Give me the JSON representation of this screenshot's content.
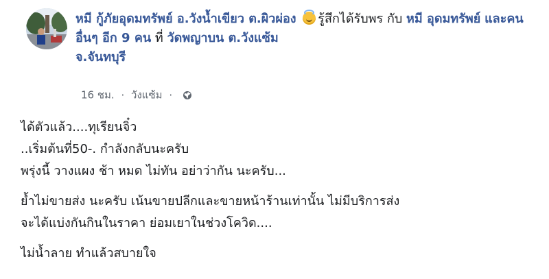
{
  "post": {
    "author_name": "หมี กู้ภัยอุดมทรัพย์ อ.วังน้ำเขียว ต.ผิวผ่อง",
    "feeling_icon": "smiling-face-with-halo-icon",
    "feeling_text": "รู้สึกได้รับพร",
    "with_word": "กับ",
    "tagged_name": "หมี อุดมทรัพย์",
    "others_text": "และคนอื่นๆ อีก 9 คน",
    "at_word": "ที่",
    "place_line1": "วัดพญาบน ต.วังแซ้ม",
    "place_line2": "จ.จันทบุรี",
    "time": "16 ชม.",
    "separator": "·",
    "location": "วังแซ้ม",
    "privacy_icon": "globe-icon"
  },
  "body": {
    "paragraphs": [
      {
        "lines": [
          "ได้ตัวแล้ว....ทุเรียนจิ๋ว",
          "..เริ่มต้นที่50-. กำลังกลับนะครับ",
          "พรุ่งนี้ วางแผง ช้า หมด ไม่ทัน อย่าว่ากัน นะครับ..."
        ]
      },
      {
        "lines": [
          "ย้ำไม่ขายส่ง นะครับ เน้นขายปลีกและขายหน้าร้านเท่านั้น ไม่มีบริการส่ง",
          "จะได้แบ่งกันกินในราคา ย่อมเยาในช่วงโควิด...."
        ]
      },
      {
        "lines": [
          "ไม่น้ำลาย ทำแล้วสบายใจ"
        ]
      }
    ]
  },
  "colors": {
    "link": "#385898",
    "text": "#1c1e21",
    "meta": "#606770"
  }
}
